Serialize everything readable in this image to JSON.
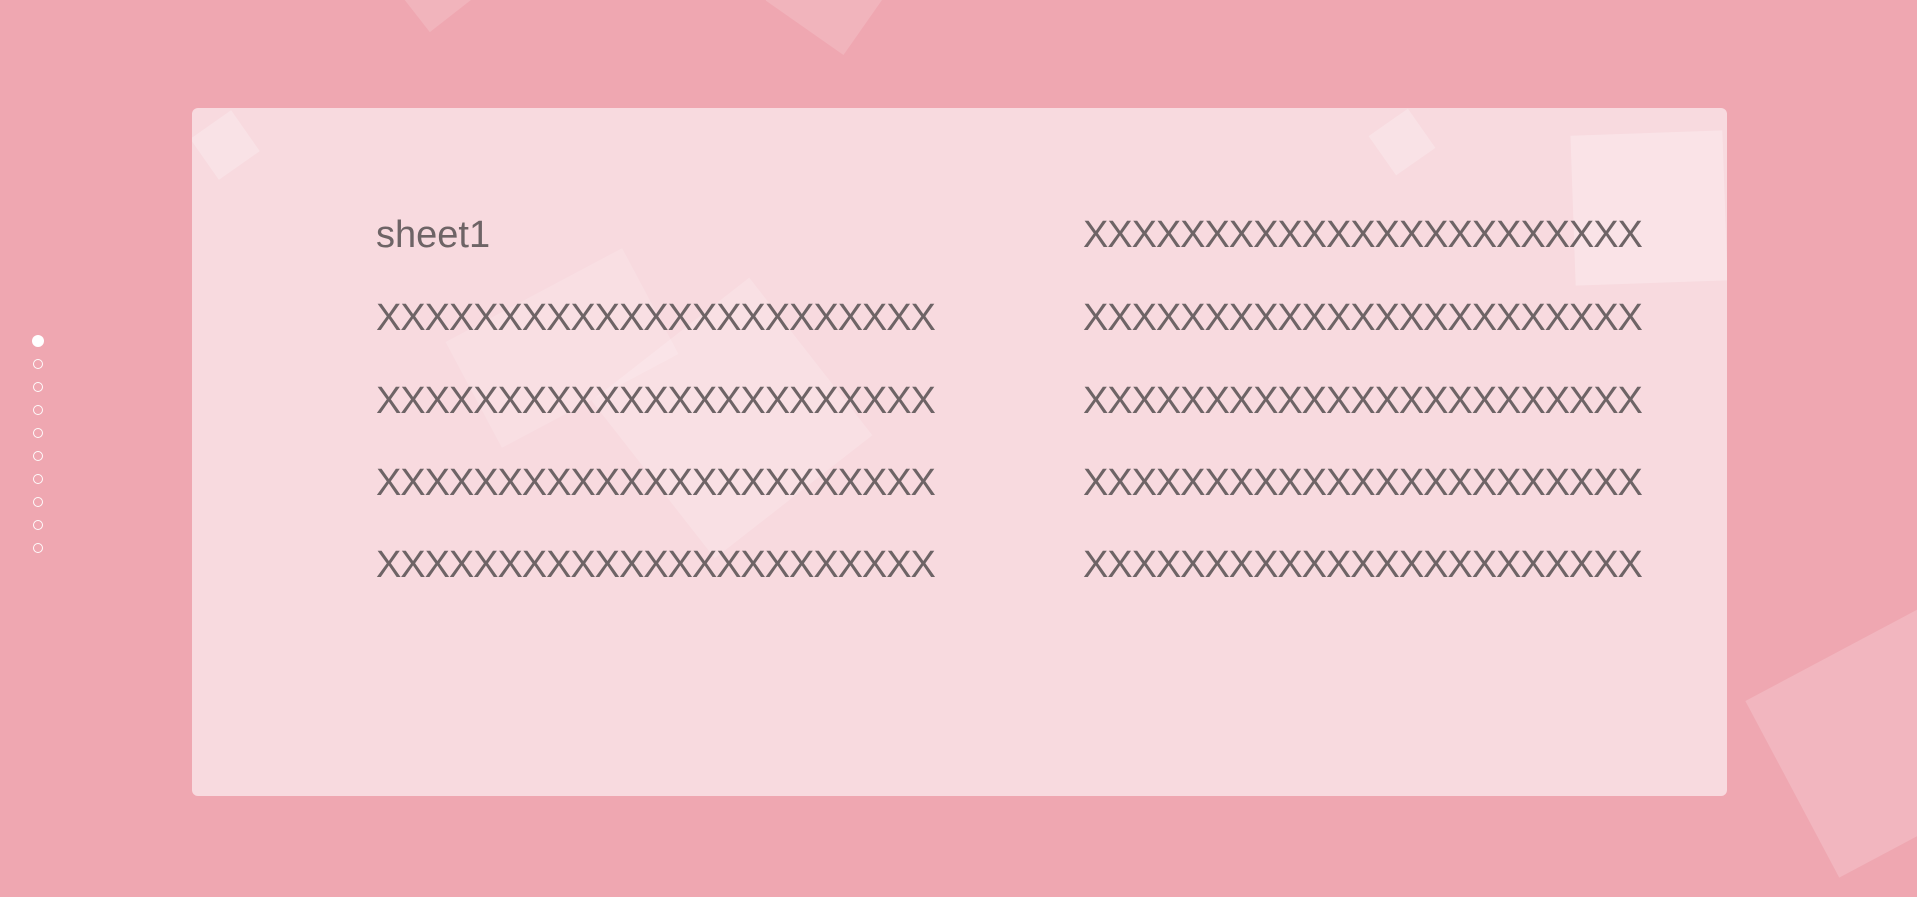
{
  "navigation": {
    "dots": [
      {
        "active": true
      },
      {
        "active": false
      },
      {
        "active": false
      },
      {
        "active": false
      },
      {
        "active": false
      },
      {
        "active": false
      },
      {
        "active": false
      },
      {
        "active": false
      },
      {
        "active": false
      },
      {
        "active": false
      }
    ]
  },
  "card": {
    "title": "sheet1",
    "left_lines": [
      "XXXXXXXXXXXXXXXXXXXXXXX",
      "XXXXXXXXXXXXXXXXXXXXXXX",
      "XXXXXXXXXXXXXXXXXXXXXXX",
      "XXXXXXXXXXXXXXXXXXXXXXX"
    ],
    "right_lines": [
      "XXXXXXXXXXXXXXXXXXXXXXX",
      "XXXXXXXXXXXXXXXXXXXXXXX",
      "XXXXXXXXXXXXXXXXXXXXXXX",
      "XXXXXXXXXXXXXXXXXXXXXXX",
      "XXXXXXXXXXXXXXXXXXXXXXX"
    ]
  },
  "colors": {
    "background": "#efa7b1",
    "card": "#f8dadf",
    "text": "#6e6466",
    "dot": "#ffffff"
  }
}
